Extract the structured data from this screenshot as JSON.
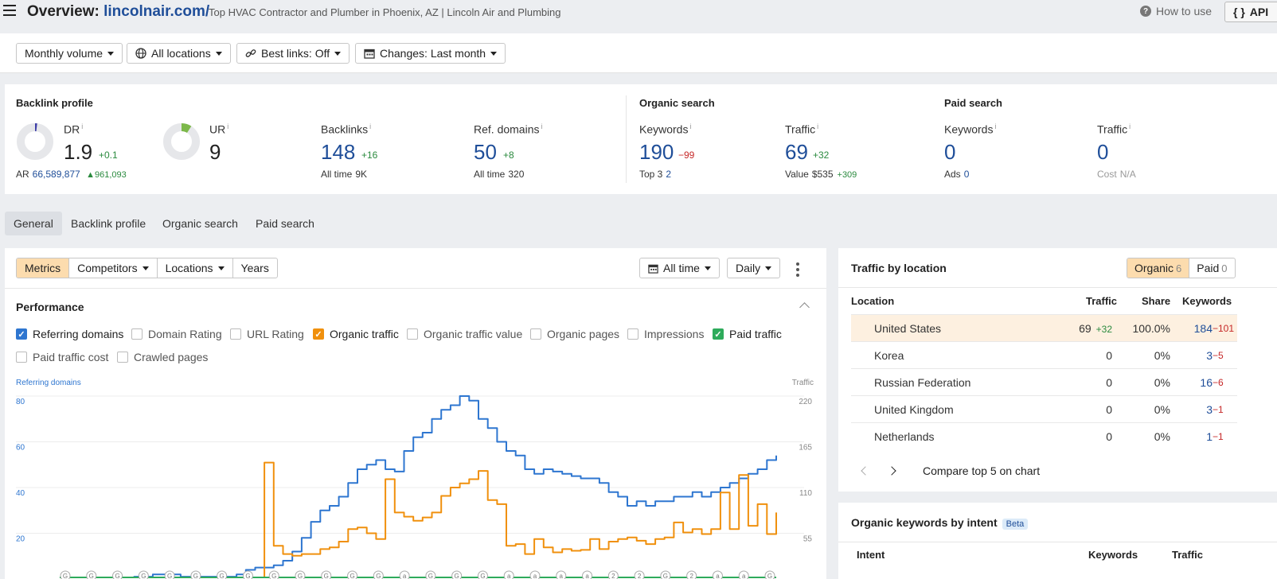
{
  "header": {
    "title_prefix": "Overview: ",
    "domain": "lincolnair.com/",
    "subtitle": "Top HVAC Contractor and Plumber in Phoenix, AZ | Lincoln Air and Plumbing",
    "how_to_use": "How to use",
    "api_label": "API",
    "api_icon": "{ }"
  },
  "filters": {
    "volume": "Monthly volume",
    "locations": "All locations",
    "best_links": "Best links: Off",
    "changes": "Changes: Last month"
  },
  "backlink_profile": {
    "title": "Backlink profile",
    "dr": {
      "label": "DR",
      "value": "1.9",
      "delta": "+0.1",
      "ring_fraction": 0.019
    },
    "ar": {
      "label": "AR",
      "value": "66,589,877",
      "delta": "961,093"
    },
    "ur": {
      "label": "UR",
      "value": "9",
      "ring_fraction": 0.09
    },
    "backlinks": {
      "label": "Backlinks",
      "value": "148",
      "delta": "+16",
      "sub_label": "All time",
      "sub_value": "9K"
    },
    "ref_domains": {
      "label": "Ref. domains",
      "value": "50",
      "delta": "+8",
      "sub_label": "All time",
      "sub_value": "320"
    }
  },
  "organic_search": {
    "title": "Organic search",
    "keywords": {
      "label": "Keywords",
      "value": "190",
      "delta": "−99",
      "sub_label": "Top 3",
      "sub_value": "2"
    },
    "traffic": {
      "label": "Traffic",
      "value": "69",
      "delta": "+32",
      "sub_label": "Value",
      "sub_value": "$535",
      "sub_delta": "+309"
    }
  },
  "paid_search": {
    "title": "Paid search",
    "keywords": {
      "label": "Keywords",
      "value": "0",
      "sub_label": "Ads",
      "sub_value": "0"
    },
    "traffic": {
      "label": "Traffic",
      "value": "0",
      "sub_label": "Cost",
      "sub_value": "N/A"
    }
  },
  "tabs": [
    "General",
    "Backlink profile",
    "Organic search",
    "Paid search"
  ],
  "toolbar": {
    "segments": [
      "Metrics",
      "Competitors",
      "Locations",
      "Years"
    ],
    "all_time": "All time",
    "daily": "Daily"
  },
  "performance": {
    "title": "Performance",
    "checkboxes": [
      {
        "label": "Referring domains",
        "checked": true
      },
      {
        "label": "Domain Rating",
        "checked": false
      },
      {
        "label": "URL Rating",
        "checked": false
      },
      {
        "label": "Organic traffic",
        "checked": true
      },
      {
        "label": "Organic traffic value",
        "checked": false
      },
      {
        "label": "Organic pages",
        "checked": false
      },
      {
        "label": "Impressions",
        "checked": false
      },
      {
        "label": "Paid traffic",
        "checked": true
      },
      {
        "label": "Paid traffic cost",
        "checked": false
      },
      {
        "label": "Crawled pages",
        "checked": false
      }
    ]
  },
  "chart_data": {
    "type": "line",
    "y_left_label": "Referring domains",
    "y_right_label": "Traffic",
    "y_left_ticks": [
      "80",
      "60",
      "40",
      "20"
    ],
    "y_right_ticks": [
      "220",
      "165",
      "110",
      "55"
    ],
    "ylim_left": [
      0,
      80
    ],
    "ylim_right": [
      0,
      220
    ],
    "series": [
      {
        "name": "Referring domains",
        "color": "#2e76d0",
        "axis": "left",
        "values": [
          0,
          0,
          0,
          0,
          0,
          0,
          0,
          0,
          1,
          1,
          2,
          2,
          2,
          1,
          1,
          1,
          1,
          1,
          1,
          2,
          4,
          5,
          5,
          6,
          8,
          12,
          18,
          25,
          30,
          32,
          36,
          42,
          48,
          50,
          52,
          48,
          47,
          56,
          62,
          64,
          70,
          74,
          76,
          80,
          78,
          70,
          66,
          60,
          56,
          54,
          48,
          46,
          48,
          47,
          46,
          45,
          44,
          44,
          42,
          38,
          36,
          32,
          34,
          32,
          34,
          34,
          36,
          36,
          38,
          36,
          38,
          40,
          42,
          44,
          46,
          48,
          52,
          54
        ]
      },
      {
        "name": "Organic traffic",
        "color": "#f0900d",
        "axis": "right",
        "values": [
          0,
          0,
          0,
          0,
          0,
          0,
          0,
          0,
          0,
          0,
          0,
          0,
          0,
          0,
          0,
          0,
          0,
          0,
          0,
          0,
          0,
          0,
          140,
          40,
          30,
          28,
          30,
          30,
          36,
          38,
          45,
          60,
          62,
          55,
          48,
          120,
          80,
          75,
          70,
          74,
          80,
          100,
          110,
          115,
          120,
          130,
          95,
          90,
          40,
          42,
          30,
          48,
          38,
          32,
          36,
          34,
          35,
          48,
          36,
          45,
          48,
          50,
          46,
          42,
          48,
          50,
          68,
          56,
          60,
          54,
          60,
          104,
          60,
          125,
          64,
          90,
          54,
          80
        ]
      },
      {
        "name": "Paid traffic",
        "color": "#2eab5b",
        "axis": "right",
        "values": [
          0,
          0,
          0,
          0,
          0,
          0,
          0,
          0,
          0,
          0,
          0,
          0,
          0,
          0,
          0,
          0,
          0,
          0,
          0,
          0,
          0,
          0,
          0,
          0,
          0,
          0,
          0,
          0,
          0,
          0,
          0,
          0,
          0,
          0,
          0,
          0,
          0,
          0,
          0,
          0,
          0,
          0,
          0,
          0,
          0,
          0,
          0,
          0,
          0,
          0,
          0,
          0,
          0,
          0,
          0,
          0,
          0,
          0,
          0,
          0,
          0,
          0,
          0,
          0,
          0,
          0,
          0,
          0,
          0,
          0,
          0,
          0,
          0,
          0,
          0,
          0,
          0,
          0
        ]
      }
    ],
    "markers": [
      "G",
      "G",
      "G",
      "G",
      "G",
      "G",
      "G",
      "G",
      "G",
      "G",
      "G",
      "G",
      "G",
      "a",
      "G",
      "G",
      "G",
      "a",
      "a",
      "a",
      "a",
      "2",
      "2",
      "G",
      "2",
      "a",
      "a",
      "G"
    ]
  },
  "traffic_by_location": {
    "title": "Traffic by location",
    "organic_label": "Organic",
    "organic_count": "6",
    "paid_label": "Paid",
    "paid_count": "0",
    "columns": [
      "Location",
      "Traffic",
      "Share",
      "Keywords"
    ],
    "rows": [
      {
        "location": "United States",
        "traffic": "69",
        "traffic_delta": "+32",
        "share": "100.0%",
        "keywords": "184",
        "keywords_delta": "−101"
      },
      {
        "location": "Korea",
        "traffic": "0",
        "traffic_delta": "",
        "share": "0%",
        "keywords": "3",
        "keywords_delta": "−5"
      },
      {
        "location": "Russian Federation",
        "traffic": "0",
        "traffic_delta": "",
        "share": "0%",
        "keywords": "16",
        "keywords_delta": "−6"
      },
      {
        "location": "United Kingdom",
        "traffic": "0",
        "traffic_delta": "",
        "share": "0%",
        "keywords": "3",
        "keywords_delta": "−1"
      },
      {
        "location": "Netherlands",
        "traffic": "0",
        "traffic_delta": "",
        "share": "0%",
        "keywords": "1",
        "keywords_delta": "−1"
      }
    ],
    "compare_label": "Compare top 5 on chart"
  },
  "keywords_by_intent": {
    "title": "Organic keywords by intent",
    "badge": "Beta",
    "columns": [
      "Intent",
      "Keywords",
      "Traffic"
    ]
  }
}
